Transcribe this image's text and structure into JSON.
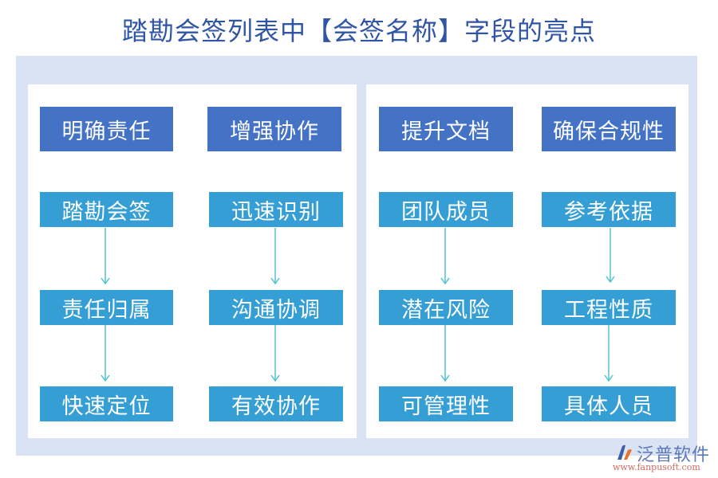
{
  "title": "踏勘会签列表中【会签名称】字段的亮点",
  "colors": {
    "header_box": "#4472c4",
    "item_box": "#359fd5",
    "arrow": "#4fc3d0",
    "frame": "#dae3f3",
    "title": "#2f55a4"
  },
  "columns": [
    {
      "header": "明确责任",
      "items": [
        "踏勘会签",
        "责任归属",
        "快速定位"
      ]
    },
    {
      "header": "增强协作",
      "items": [
        "迅速识别",
        "沟通协调",
        "有效协作"
      ]
    },
    {
      "header": "提升文档",
      "items": [
        "团队成员",
        "潜在风险",
        "可管理性"
      ]
    },
    {
      "header": "确保合规性",
      "items": [
        "参考依据",
        "工程性质",
        "具体人员"
      ]
    }
  ],
  "watermark": {
    "brand": "泛普软件",
    "url": "www.fanpusoft.com"
  }
}
